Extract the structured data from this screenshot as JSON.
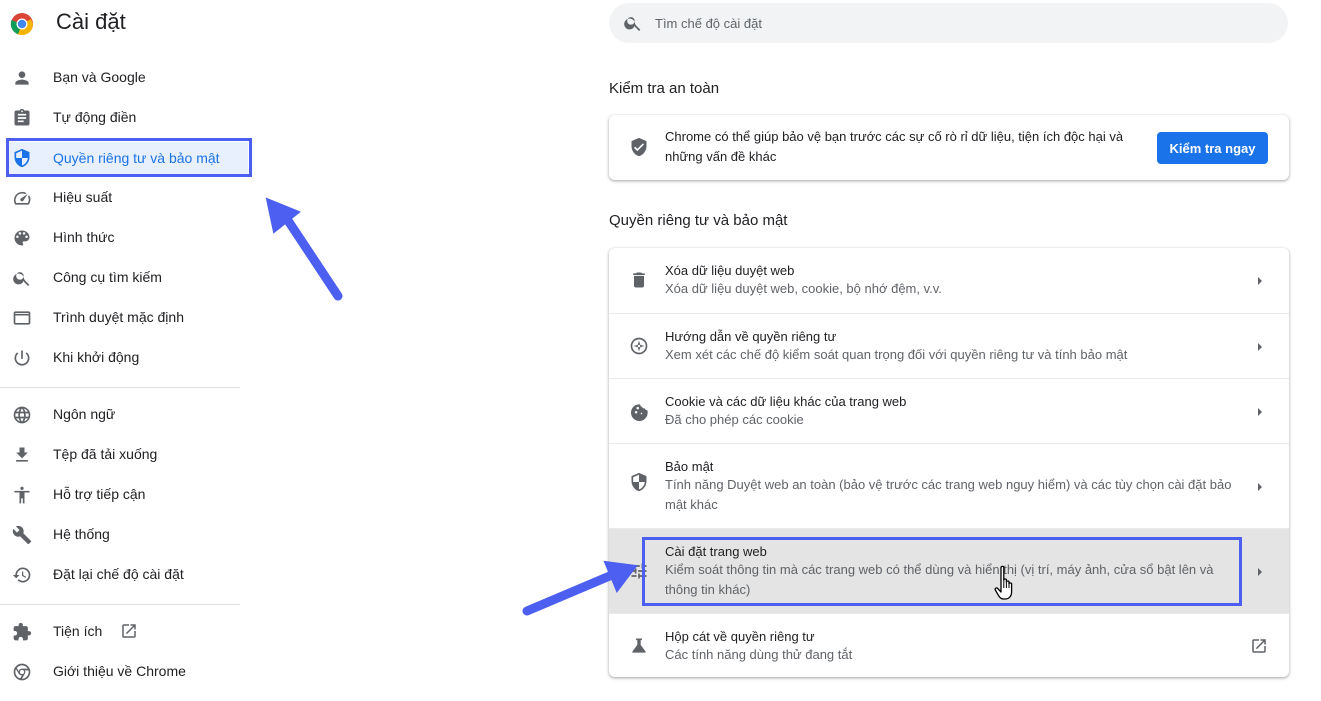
{
  "app": {
    "title": "Cài đặt"
  },
  "search": {
    "placeholder": "Tìm chế độ cài đặt",
    "value": ""
  },
  "sidebar": {
    "items": [
      {
        "label": "Bạn và Google",
        "icon": "person-icon"
      },
      {
        "label": "Tự động điền",
        "icon": "clipboard-icon"
      },
      {
        "label": "Quyền riêng tư và bảo mật",
        "icon": "shield-icon",
        "active": true
      },
      {
        "label": "Hiệu suất",
        "icon": "speedometer-icon"
      },
      {
        "label": "Hình thức",
        "icon": "palette-icon"
      },
      {
        "label": "Công cụ tìm kiếm",
        "icon": "search-icon"
      },
      {
        "label": "Trình duyệt mặc định",
        "icon": "browser-icon"
      },
      {
        "label": "Khi khởi động",
        "icon": "power-icon"
      },
      {
        "label": "Ngôn ngữ",
        "icon": "globe-icon"
      },
      {
        "label": "Tệp đã tải xuống",
        "icon": "download-icon"
      },
      {
        "label": "Hỗ trợ tiếp cận",
        "icon": "accessibility-icon"
      },
      {
        "label": "Hệ thống",
        "icon": "wrench-icon"
      },
      {
        "label": "Đặt lại chế độ cài đặt",
        "icon": "restore-icon"
      },
      {
        "label": "Tiện ích",
        "icon": "puzzle-icon"
      },
      {
        "label": "Giới thiệu về Chrome",
        "icon": "chrome-icon"
      }
    ]
  },
  "safety": {
    "section_title": "Kiểm tra an toàn",
    "text": "Chrome có thể giúp bảo vệ bạn trước các sự cố rò rỉ dữ liệu, tiện ích độc hại và những vấn đề khác",
    "button": "Kiểm tra ngay"
  },
  "privacy": {
    "section_title": "Quyền riêng tư và bảo mật",
    "rows": [
      {
        "title": "Xóa dữ liệu duyệt web",
        "sub": "Xóa dữ liệu duyệt web, cookie, bộ nhớ đệm, v.v.",
        "icon": "trash-icon"
      },
      {
        "title": "Hướng dẫn về quyền riêng tư",
        "sub": "Xem xét các chế độ kiểm soát quan trọng đối với quyền riêng tư và tính bảo mật",
        "icon": "compass-icon"
      },
      {
        "title": "Cookie và các dữ liệu khác của trang web",
        "sub": "Đã cho phép các cookie",
        "icon": "cookie-icon"
      },
      {
        "title": "Bảo mật",
        "sub": "Tính năng Duyệt web an toàn (bảo vệ trước các trang web nguy hiểm) và các tùy chọn cài đặt bảo mật khác",
        "icon": "shield-icon"
      },
      {
        "title": "Cài đặt trang web",
        "sub": "Kiểm soát thông tin mà các trang web có thể dùng và hiển thị (vị trí, máy ảnh, cửa sổ bật lên và thông tin khác)",
        "icon": "tune-icon"
      },
      {
        "title": "Hộp cát về quyền riêng tư",
        "sub": "Các tính năng dùng thử đang tắt",
        "icon": "flask-icon"
      }
    ]
  },
  "colors": {
    "accent": "#1a73e8",
    "annotation": "#4c5ff0",
    "hover_row": "#e4e4e4"
  }
}
